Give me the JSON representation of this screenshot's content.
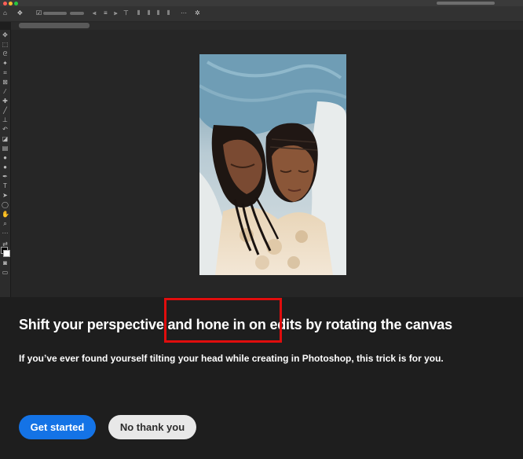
{
  "colors": {
    "accent": "#1473e6",
    "highlight": "#e00d0d",
    "traffic_close": "#ff5f57",
    "traffic_minimize": "#febc2e",
    "traffic_zoom": "#28c840"
  },
  "optionsbar": {
    "icons": [
      "home-icon",
      "move-icon",
      "auto-select-icon",
      "align-icon",
      "distribute-icon",
      "more-icon",
      "settings-icon"
    ]
  },
  "toolbar": {
    "tools": [
      "move-tool",
      "marquee-tool",
      "lasso-tool",
      "magic-wand-tool",
      "crop-tool",
      "frame-tool",
      "eyedropper-tool",
      "healing-brush-tool",
      "brush-tool",
      "clone-stamp-tool",
      "history-brush-tool",
      "eraser-tool",
      "gradient-tool",
      "blur-tool",
      "dodge-tool",
      "pen-tool",
      "type-tool",
      "path-selection-tool",
      "shape-tool",
      "hand-tool",
      "zoom-tool",
      "more-tools",
      "foreground-background-colors",
      "quick-mask",
      "screen-mode"
    ]
  },
  "onboarding": {
    "headline": "Shift your perspective and hone in on edits by rotating the canvas",
    "description": "If you’ve ever found yourself tilting your head while creating in Photoshop, this trick is for you.",
    "primary_button": "Get started",
    "secondary_button": "No thank you"
  }
}
